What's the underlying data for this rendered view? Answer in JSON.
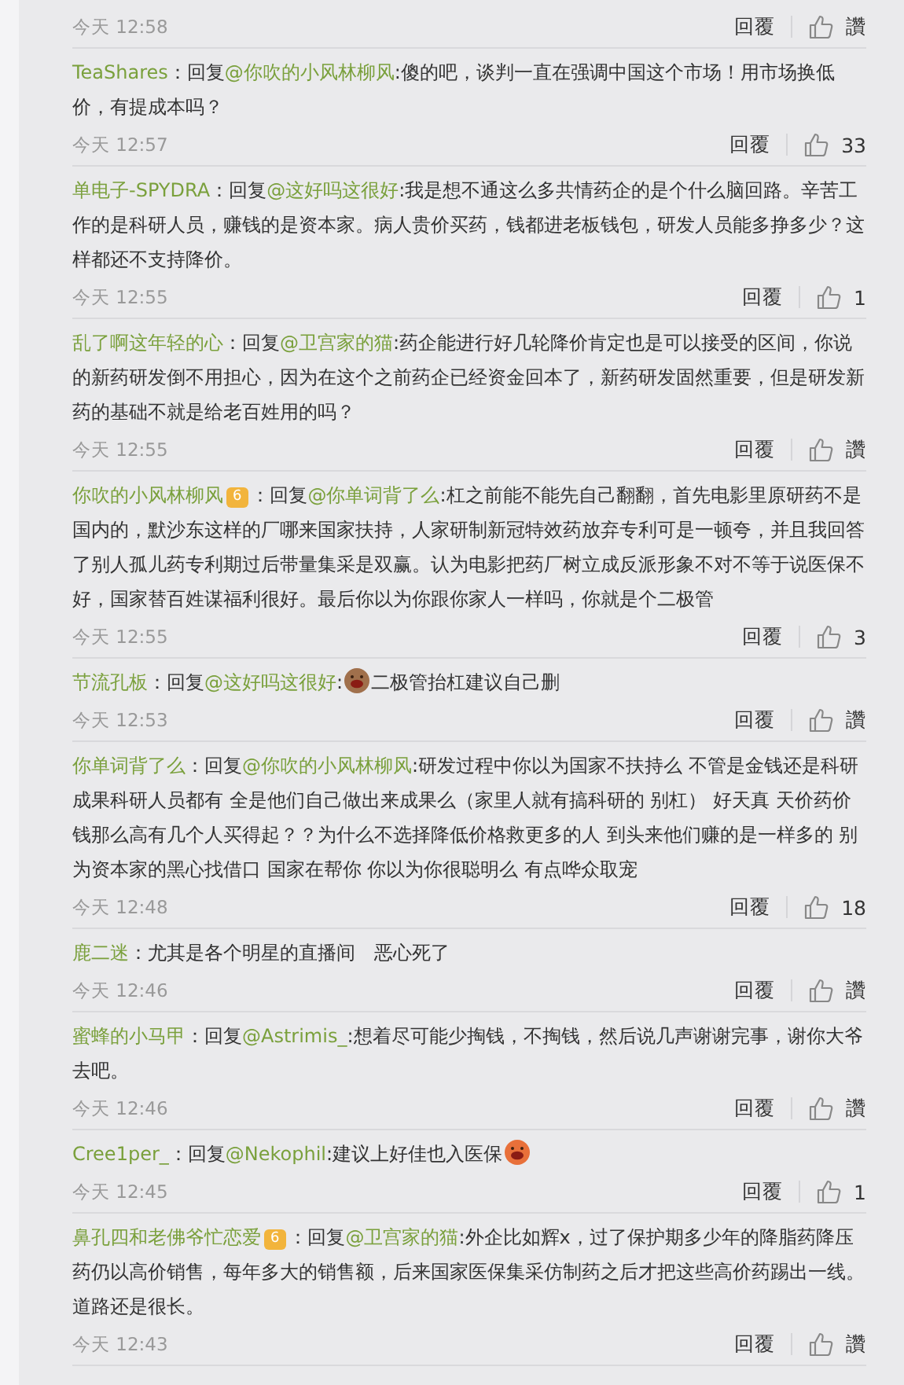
{
  "comments": [
    {
      "time": "今天 12:58",
      "reply_label": "回覆",
      "likes": "讚"
    },
    {
      "user": "TeaShares",
      "lead": "：回复",
      "mention": "@你吹的小风林柳风",
      "text": ":傻的吧，谈判一直在强调中国这个市场！用市场换低价，有提成本吗？",
      "time": "今天 12:57",
      "reply_label": "回覆",
      "likes": "33"
    },
    {
      "user": "单电子-SPYDRA",
      "lead": "：回复",
      "mention": "@这好吗这很好",
      "text": ":我是想不通这么多共情药企的是个什么脑回路。辛苦工作的是科研人员，赚钱的是资本家。病人贵价买药，钱都进老板钱包，研发人员能多挣多少？这样都还不支持降价。",
      "time": "今天 12:55",
      "reply_label": "回覆",
      "likes": "1"
    },
    {
      "user": "乱了啊这年轻的心",
      "lead": "：回复",
      "mention": "@卫宫家的猫",
      "text": ":药企能进行好几轮降价肯定也是可以接受的区间，你说的新药研发倒不用担心，因为在这个之前药企已经资金回本了，新药研发固然重要，但是研发新药的基础不就是给老百姓用的吗？",
      "time": "今天 12:55",
      "reply_label": "回覆",
      "likes": "讚"
    },
    {
      "user": "你吹的小风林柳风",
      "badge": "6",
      "lead": "：回复",
      "mention": "@你单词背了么",
      "text": ":杠之前能不能先自己翻翻，首先电影里原研药不是国内的，默沙东这样的厂哪来国家扶持，人家研制新冠特效药放弃专利可是一顿夸，并且我回答了别人孤儿药专利期过后带量集采是双赢。认为电影把药厂树立成反派形象不对不等于说医保不好，国家替百姓谋福利很好。最后你以为你跟你家人一样吗，你就是个二极管",
      "time": "今天 12:55",
      "reply_label": "回覆",
      "likes": "3"
    },
    {
      "user": "节流孔板",
      "lead": "：回复",
      "mention": "@这好吗这很好",
      "text": ":",
      "emoji": {
        "color": "#a0704c"
      },
      "text_after": "二极管抬杠建议自己删",
      "time": "今天 12:53",
      "reply_label": "回覆",
      "likes": "讚"
    },
    {
      "user": "你单词背了么",
      "lead": "：回复",
      "mention": "@你吹的小风林柳风",
      "text": ":研发过程中你以为国家不扶持么 不管是金钱还是科研成果科研人员都有 全是他们自己做出来成果么（家里人就有搞科研的 别杠） 好天真 天价药价钱那么高有几个人买得起？？为什么不选择降低价格救更多的人 到头来他们赚的是一样多的 别为资本家的黑心找借口 国家在帮你 你以为你很聪明么 有点哗众取宠",
      "time": "今天 12:48",
      "reply_label": "回覆",
      "likes": "18"
    },
    {
      "user": "鹿二迷",
      "lead": "：",
      "text": "尤其是各个明星的直播间　恶心死了",
      "time": "今天 12:46",
      "reply_label": "回覆",
      "likes": "讚"
    },
    {
      "user": "蜜蜂的小马甲",
      "lead": "：回复",
      "mention": "@Astrimis_",
      "text": ":想着尽可能少掏钱，不掏钱，然后说几声谢谢完事，谢你大爷去吧。",
      "time": "今天 12:46",
      "reply_label": "回覆",
      "likes": "讚"
    },
    {
      "user": "Cree1per_",
      "lead": "：回复",
      "mention": "@Nekophil",
      "text": ":建议上好佳也入医保",
      "emoji": {
        "color": "#e8703a"
      },
      "time": "今天 12:45",
      "reply_label": "回覆",
      "likes": "1"
    },
    {
      "user": "鼻孔四和老佛爷忙恋爱",
      "badge": "6",
      "lead": "：回复",
      "mention": "@卫宫家的猫",
      "text": ":外企比如辉x，过了保护期多少年的降脂药降压药仍以高价销售，每年多大的销售额，后来国家医保集采仿制药之后才把这些高价药踢出一线。道路还是很长。",
      "time": "今天 12:43",
      "reply_label": "回覆",
      "likes": "讚"
    }
  ]
}
